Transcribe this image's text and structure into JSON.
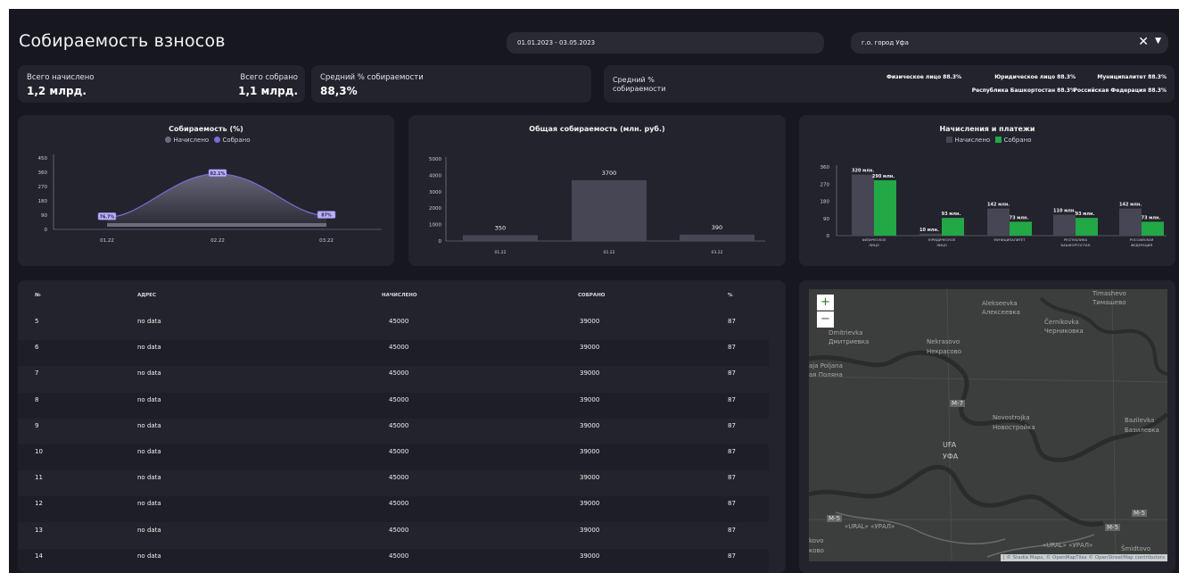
{
  "header": {
    "title": "Собираемость взносов",
    "date_range": "01.01.2023 - 03.05.2023",
    "city_filter": "г.о. город Уфа"
  },
  "kpi": {
    "total_charged_label": "Всего начислено",
    "total_charged_value": "1,2 млрд.",
    "total_collected_label": "Всего собрано",
    "total_collected_value": "1,1 млрд.",
    "avg_label": "Средний % собираемости",
    "avg_value": "88,3%",
    "avg2_label_line1": "Средний %",
    "avg2_label_line2": "собираемости",
    "regions": [
      "Физическое лицо 88.3%",
      "Юридическое лицо 88.3%",
      "Муниципалитет 88.3%",
      "Республика Башкортостан 88.3%",
      "Российская Федерация 88.3%"
    ]
  },
  "chart_data": [
    {
      "type": "area",
      "title": "Собираемость (%)",
      "legend": [
        "Начислено",
        "Собрано"
      ],
      "colors": {
        "charged": "#6b6b7b",
        "collected": "#7b6bd6"
      },
      "categories": [
        "01.22",
        "02.22",
        "03.22"
      ],
      "yticks": [
        0,
        90,
        180,
        270,
        360,
        450
      ],
      "ylim": [
        0,
        450
      ],
      "series": [
        {
          "name": "Собрано",
          "values": [
            76.7,
            350,
            87
          ],
          "labels": [
            "76.7%",
            "82.1%",
            "87%"
          ]
        }
      ]
    },
    {
      "type": "bar",
      "title": "Общая собираемость (млн. руб.)",
      "categories": [
        "01.22",
        "02.22",
        "03.22"
      ],
      "values": [
        350,
        3700,
        390
      ],
      "yticks": [
        0,
        1000,
        2000,
        3000,
        4000,
        5000
      ],
      "ylim": [
        0,
        5000
      ],
      "color": "#464654"
    },
    {
      "type": "bar",
      "title": "Начисления и платежи",
      "legend": [
        "Начислено",
        "Собрано"
      ],
      "colors": {
        "charged": "#464654",
        "collected": "#22a845"
      },
      "categories": [
        [
          "ФИЗИЧЕСКОЕ",
          "ЛИЦО"
        ],
        [
          "ЮРИДИЧЕСКОЕ",
          "ЛИЦО"
        ],
        [
          "МУНИЦИПАЛИТЕТ"
        ],
        [
          "РЕСПУБЛИКА",
          "БАШКОРТОСТАН"
        ],
        [
          "РОССИЙСКАЯ",
          "ФЕДЕРАЦИЯ"
        ]
      ],
      "yticks": [
        0,
        90,
        180,
        270,
        360
      ],
      "ylim": [
        0,
        360
      ],
      "series": [
        {
          "name": "Начислено",
          "values": [
            320,
            10,
            142,
            110,
            142
          ],
          "labels": [
            "320 млн.",
            "10 млн.",
            "142 млн.",
            "110 млн.",
            "142 млн."
          ]
        },
        {
          "name": "Собрано",
          "values": [
            290,
            93,
            73,
            93,
            73
          ],
          "labels": [
            "290 млн.",
            "93 млн.",
            "73 млн.",
            "93 млн.",
            "73 млн."
          ]
        }
      ]
    }
  ],
  "table": {
    "headers": [
      "№",
      "АДРЕС",
      "НАЧИСЛЕНО",
      "СОБРАНО",
      "%"
    ],
    "rows": [
      [
        "5",
        "no data",
        "45000",
        "39000",
        "87"
      ],
      [
        "6",
        "no data",
        "45000",
        "39000",
        "87"
      ],
      [
        "7",
        "no data",
        "45000",
        "39000",
        "87"
      ],
      [
        "8",
        "no data",
        "45000",
        "39000",
        "87"
      ],
      [
        "9",
        "no data",
        "45000",
        "39000",
        "87"
      ],
      [
        "10",
        "no data",
        "45000",
        "39000",
        "87"
      ],
      [
        "11",
        "no data",
        "45000",
        "39000",
        "87"
      ],
      [
        "12",
        "no data",
        "45000",
        "39000",
        "87"
      ],
      [
        "13",
        "no data",
        "45000",
        "39000",
        "87"
      ],
      [
        "14",
        "no data",
        "45000",
        "39000",
        "87"
      ]
    ]
  },
  "map": {
    "zoom_in": "+",
    "zoom_out": "−",
    "labels": [
      "Alekseevka",
      "Алексеевка",
      "Timashevo",
      "Тимашево",
      "Dmitrievka",
      "Дмитриевка",
      "Nekrasovo",
      "Некрасово",
      "Černikovka",
      "Черниковка",
      "aja Poljana",
      "ая Поляна",
      "M-7",
      "Novostrojka",
      "Новостройка",
      "Bazilevka",
      "Базилевка",
      "UFA",
      "УФА",
      "M-5",
      "M-5",
      "M-5",
      "«URAL» «УРАЛ»",
      "«URAL» «УРАЛ»",
      "kovo",
      "ково",
      "Šmidtovo"
    ],
    "attribution": "| © Stadia Maps, © OpenMapTiles © OpenStreetMap contributors"
  }
}
